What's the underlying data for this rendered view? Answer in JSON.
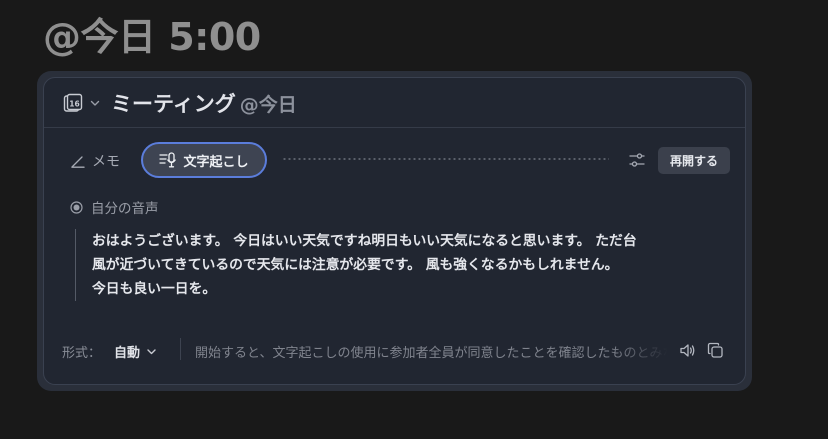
{
  "heading": "@今日 5:00",
  "card": {
    "title": "ミーティング",
    "title_suffix": "@今日",
    "calendar_day": "16"
  },
  "tabs": {
    "memo": "メモ",
    "transcript": "文字起こし"
  },
  "actions": {
    "resume": "再開する"
  },
  "speaker": {
    "label": "自分の音声"
  },
  "transcript": {
    "text": "おはようございます。 今日はいい天気ですね明日もいい天気になると思います。 ただ台\n風が近づいてきているので天気には注意が必要です。 風も強くなるかもしれません。\n今日も良い一日を。"
  },
  "footer": {
    "format_label": "形式：",
    "format_value": "自動",
    "consent": "開始すると、文字起こしの使用に参加者全員が同意したことを確認したものとみなされます"
  },
  "icons": {
    "calendar": "calendar-icon",
    "chevron": "chevron-down-icon",
    "pen": "pen-icon",
    "transcript": "transcript-mic-icon",
    "settings": "sliders-icon",
    "radio": "radio-icon",
    "sound": "speaker-icon",
    "copy": "copy-icon"
  },
  "colors": {
    "background": "#191919",
    "card": "#212631",
    "accent": "#5b7ddb",
    "heading": "#8f8f8f"
  }
}
